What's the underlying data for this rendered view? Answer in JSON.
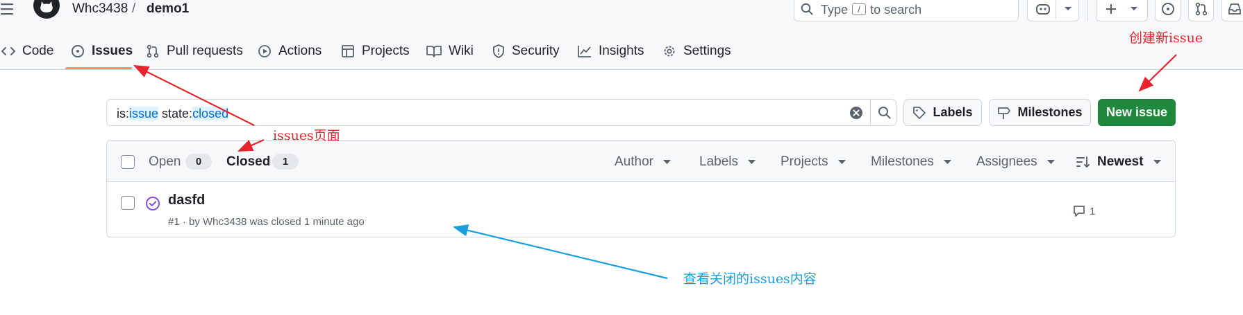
{
  "header": {
    "owner": "Whc3438",
    "separator": "/",
    "repo": "demo1",
    "search": {
      "prefix": "Type",
      "key": "/",
      "suffix": "to search"
    },
    "tabs": [
      {
        "label": "Code",
        "icon": "code-icon"
      },
      {
        "label": "Issues",
        "icon": "issue-opened-icon",
        "active": true
      },
      {
        "label": "Pull requests",
        "icon": "git-pull-request-icon"
      },
      {
        "label": "Actions",
        "icon": "play-icon"
      },
      {
        "label": "Projects",
        "icon": "table-icon"
      },
      {
        "label": "Wiki",
        "icon": "book-icon"
      },
      {
        "label": "Security",
        "icon": "shield-icon"
      },
      {
        "label": "Insights",
        "icon": "graph-icon"
      },
      {
        "label": "Settings",
        "icon": "gear-icon"
      }
    ]
  },
  "filter": {
    "q1": "is:",
    "q2": "issue",
    "q3": " state:",
    "q4": "closed",
    "labels_button": "Labels",
    "milestones_button": "Milestones",
    "new_issue_button": "New issue"
  },
  "issues": {
    "open_label": "Open",
    "open_count": "0",
    "closed_label": "Closed",
    "closed_count": "1",
    "filters": [
      "Author",
      "Labels",
      "Projects",
      "Milestones",
      "Assignees"
    ],
    "sort": "Newest",
    "rows": [
      {
        "title": "dasfd",
        "meta": "#1 · by Whc3438 was closed 1 minute ago",
        "comments": "1"
      }
    ]
  },
  "annotations": {
    "new_issue": "创建新issue",
    "issues_page": "issues页面",
    "closed_issues": "查看关闭的issues内容"
  },
  "colors": {
    "annotation_red": "#e8242f",
    "annotation_blue": "#17a0dd",
    "primary_green": "#1f883d",
    "closed_purple": "#8250df",
    "tab_underline": "#fd8c73"
  }
}
